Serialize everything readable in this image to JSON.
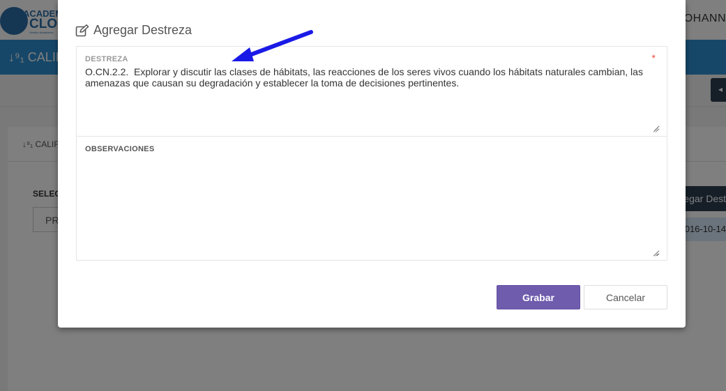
{
  "background": {
    "logo": {
      "line1": "ACADEM",
      "line2": "CLOU",
      "line3": "Gestión Académica"
    },
    "user_name": "OHANN",
    "section_title": "CALIFI",
    "tab_label": "CALIF",
    "select_label": "SELEC",
    "select_value": "PR",
    "add_button_label": "egar Dest",
    "row_date": "016-10-14"
  },
  "modal": {
    "title": "Agregar Destreza",
    "fields": {
      "destreza": {
        "label": "DESTREZA",
        "required_mark": "*",
        "value": "O.CN.2.2.  Explorar y discutir las clases de hábitats, las reacciones de los seres vivos cuando los hábitats naturales cambian, las amenazas que causan su degradación y establecer la toma de decisiones pertinentes."
      },
      "observaciones": {
        "label": "OBSERVACIONES",
        "value": ""
      }
    },
    "buttons": {
      "save_label": "Grabar",
      "cancel_label": "Cancelar"
    }
  },
  "colors": {
    "primary_button": "#6f5cad",
    "header_bar": "#2f8fd0",
    "annotation_arrow": "#1a1ae6",
    "required": "#e74c3c"
  },
  "icons": {
    "title_icon": "edit-icon",
    "annotation": "arrow-annotation-icon"
  }
}
